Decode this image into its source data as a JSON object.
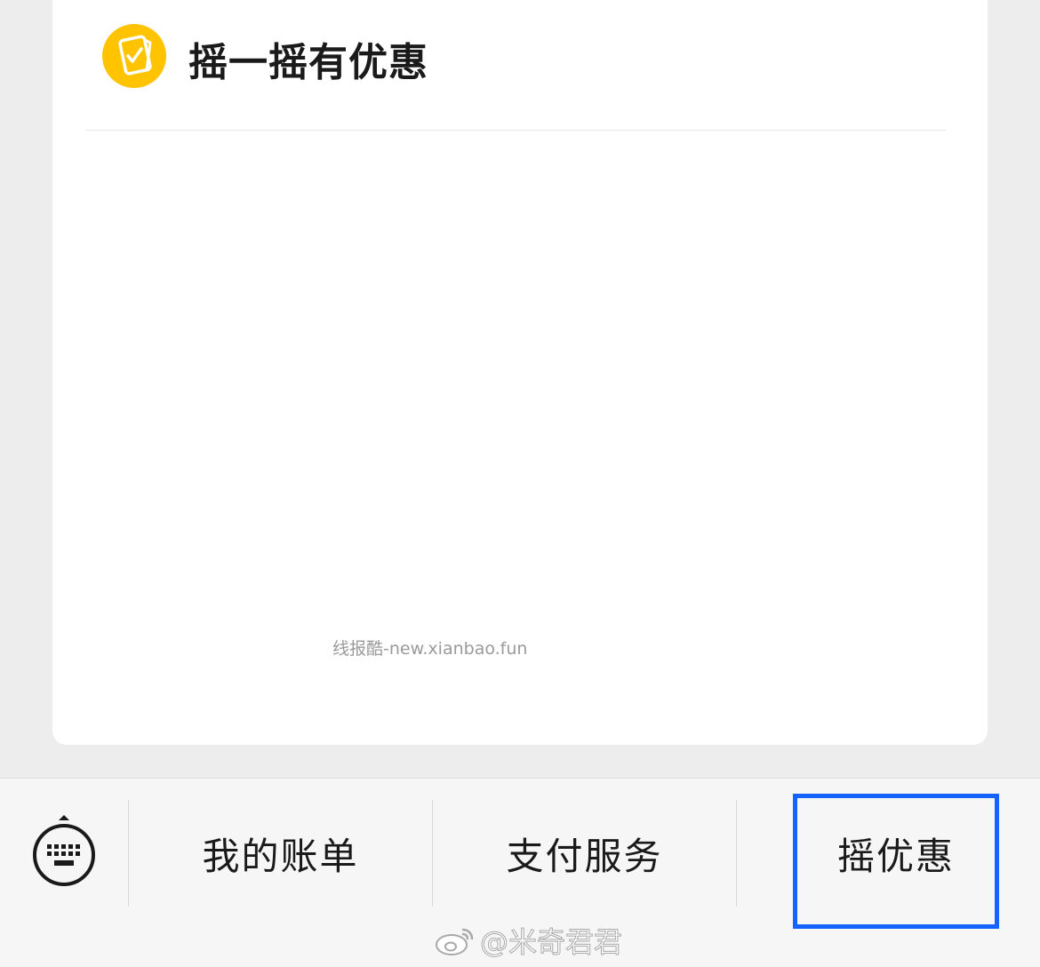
{
  "card": {
    "title": "摇一摇有优惠",
    "watermark": "线报酷-new.xianbao.fun"
  },
  "bottom_menu": {
    "items": [
      {
        "label": "我的账单"
      },
      {
        "label": "支付服务"
      },
      {
        "label": "摇优惠"
      }
    ],
    "highlighted_item": "摇优惠"
  },
  "overlay": {
    "weibo_watermark": "@米奇君君"
  },
  "colors": {
    "background": "#ededed",
    "card": "#ffffff",
    "logo": "#FFC300",
    "highlight_border": "#1463FF",
    "bottom_bar": "#f6f6f6"
  },
  "icons": {
    "logo": "coupon-card-icon",
    "keyboard": "keyboard-icon",
    "weibo": "weibo-icon"
  }
}
